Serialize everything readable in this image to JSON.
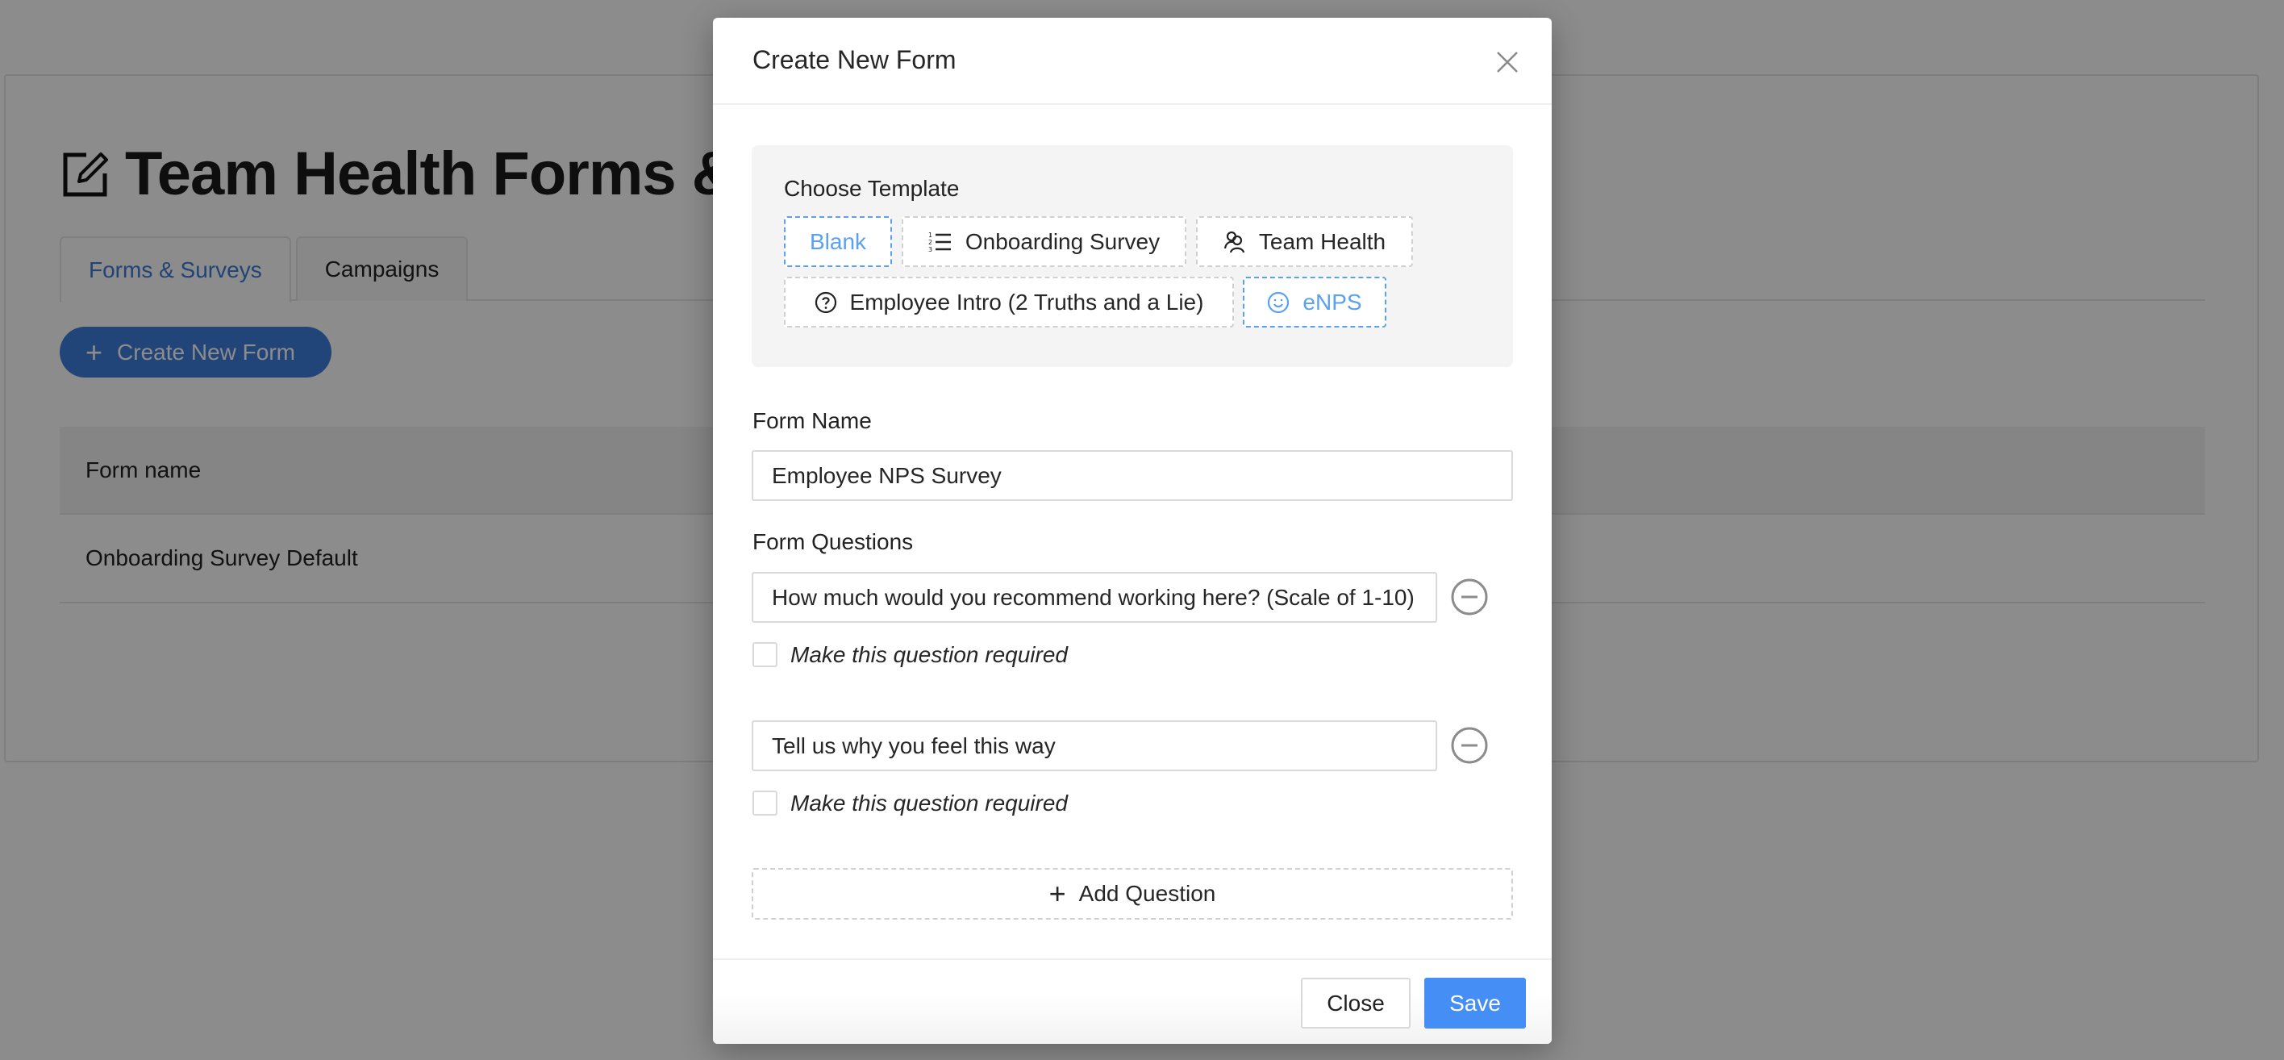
{
  "page": {
    "title": "Team Health Forms & Surveys",
    "title_icon": "edit-square-icon",
    "tabs": [
      {
        "label": "Forms & Surveys",
        "active": true
      },
      {
        "label": "Campaigns",
        "active": false
      }
    ],
    "create_button": {
      "label": "Create New Form",
      "icon": "plus-icon"
    },
    "table": {
      "columns": [
        "Form name"
      ],
      "rows": [
        [
          "Onboarding Survey Default"
        ]
      ]
    }
  },
  "modal": {
    "title": "Create New Form",
    "close_icon": "close-icon",
    "template_section": {
      "label": "Choose Template",
      "templates": [
        {
          "label": "Blank",
          "icon": null,
          "selected": true
        },
        {
          "label": "Onboarding Survey",
          "icon": "ordered-list-icon",
          "selected": false
        },
        {
          "label": "Team Health",
          "icon": "team-icon",
          "selected": false
        },
        {
          "label": "Employee Intro (2 Truths and a Lie)",
          "icon": "question-circle-icon",
          "selected": false
        },
        {
          "label": "eNPS",
          "icon": "smile-icon",
          "selected": true
        }
      ]
    },
    "form_name": {
      "label": "Form Name",
      "value": "Employee NPS Survey"
    },
    "form_questions": {
      "label": "Form Questions",
      "questions": [
        {
          "value": "How much would you recommend working here? (Scale of 1-10)",
          "required_label": "Make this question required",
          "required": false
        },
        {
          "value": "Tell us why you feel this way",
          "required_label": "Make this question required",
          "required": false
        }
      ],
      "add_button": "Add Question"
    },
    "footer": {
      "close_label": "Close",
      "save_label": "Save"
    }
  },
  "colors": {
    "accent": "#448ef6",
    "selected_template": "#5aa1f0",
    "active_tab": "#3d7ad6"
  }
}
